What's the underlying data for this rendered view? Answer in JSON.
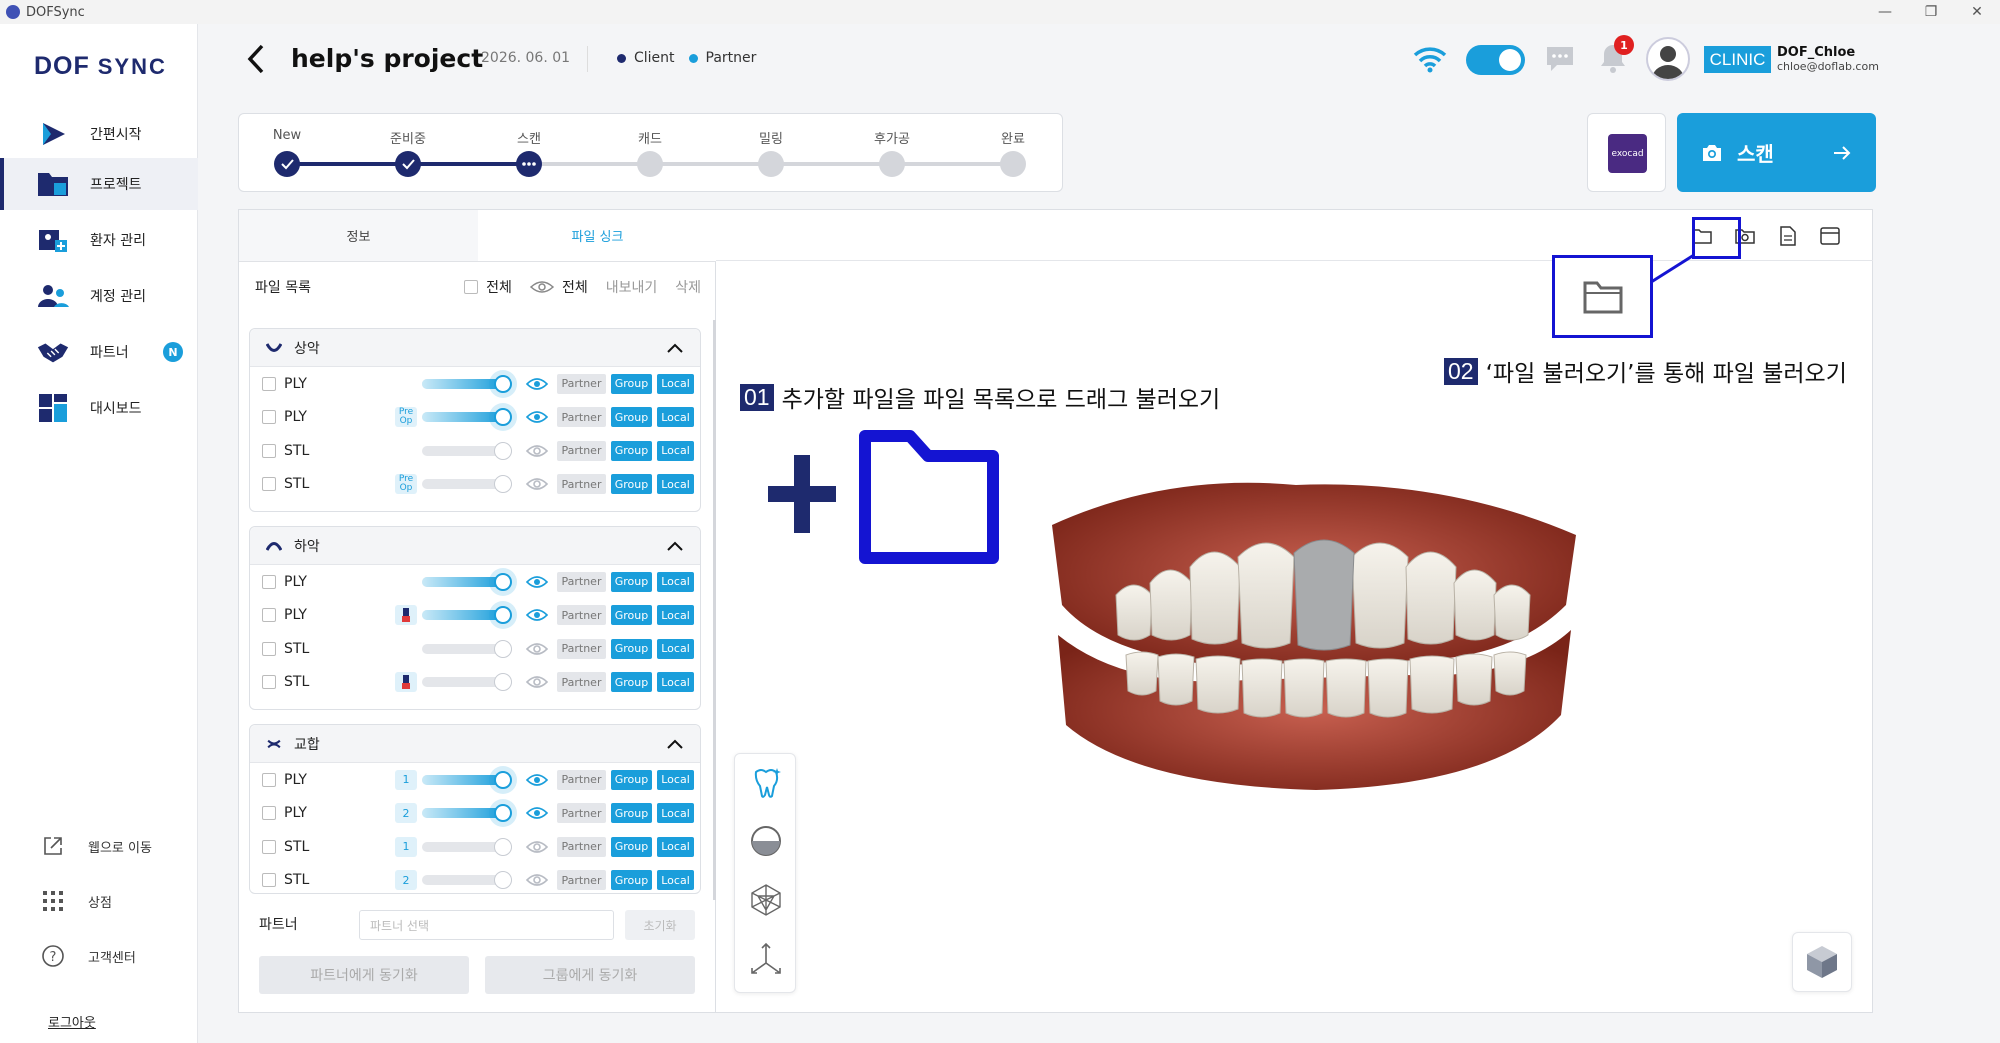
{
  "window": {
    "title": "DOFSync",
    "controls": [
      "—",
      "❐",
      "✕"
    ]
  },
  "sidebar": {
    "logo": {
      "main": "DOF",
      "sub": "SYNC"
    },
    "items": [
      {
        "label": "간편시작",
        "icon": "play-icon"
      },
      {
        "label": "프로젝트",
        "icon": "folder-icon",
        "active": true
      },
      {
        "label": "환자 관리",
        "icon": "patient-icon"
      },
      {
        "label": "계정 관리",
        "icon": "account-icon"
      },
      {
        "label": "파트너",
        "icon": "handshake-icon",
        "badge": "N"
      },
      {
        "label": "대시보드",
        "icon": "dashboard-icon"
      }
    ],
    "bottom": [
      {
        "label": "웹으로 이동",
        "icon": "external-link-icon"
      },
      {
        "label": "상점",
        "icon": "grid-icon"
      },
      {
        "label": "고객센터",
        "icon": "help-icon"
      }
    ],
    "logout": "로그아웃"
  },
  "header": {
    "title": "help's project",
    "date": "2026. 06. 01",
    "legend": [
      {
        "label": "Client",
        "color": "#1e2a6e"
      },
      {
        "label": "Partner",
        "color": "#1a9edb"
      }
    ],
    "notification_count": "1",
    "clinic_badge": "CLINIC",
    "user_name": "DOF_Chloe",
    "user_email": "chloe@doflab.com"
  },
  "progress": {
    "steps": [
      {
        "label": "New",
        "state": "done"
      },
      {
        "label": "준비중",
        "state": "done"
      },
      {
        "label": "스캔",
        "state": "current"
      },
      {
        "label": "캐드",
        "state": "pending"
      },
      {
        "label": "밀링",
        "state": "pending"
      },
      {
        "label": "후가공",
        "state": "pending"
      },
      {
        "label": "완료",
        "state": "pending"
      }
    ]
  },
  "exocad": {
    "label": "exocad"
  },
  "scan_button": {
    "label": "스캔"
  },
  "panel": {
    "tabs": [
      {
        "label": "정보"
      },
      {
        "label": "파일 싱크",
        "active": true
      }
    ],
    "filelist": {
      "title": "파일 목록",
      "select_all": "전체",
      "view_all": "전체",
      "export": "내보내기",
      "delete": "삭제"
    },
    "groups": [
      {
        "title": "상악",
        "rows": [
          {
            "type": "PLY",
            "extra": "",
            "on": true
          },
          {
            "type": "PLY",
            "extra": "Pre Op",
            "on": true
          },
          {
            "type": "STL",
            "extra": "",
            "on": false
          },
          {
            "type": "STL",
            "extra": "Pre Op",
            "on": false
          }
        ]
      },
      {
        "title": "하악",
        "rows": [
          {
            "type": "PLY",
            "extra": "",
            "on": true
          },
          {
            "type": "PLY",
            "extra": "tooth",
            "on": true
          },
          {
            "type": "STL",
            "extra": "",
            "on": false
          },
          {
            "type": "STL",
            "extra": "tooth",
            "on": false
          }
        ]
      },
      {
        "title": "교합",
        "rows": [
          {
            "type": "PLY",
            "extra": "1",
            "on": true
          },
          {
            "type": "PLY",
            "extra": "2",
            "on": true
          },
          {
            "type": "STL",
            "extra": "1",
            "on": false
          },
          {
            "type": "STL",
            "extra": "2",
            "on": false
          }
        ]
      }
    ],
    "pills": {
      "partner": "Partner",
      "group": "Group",
      "local": "Local"
    },
    "partner_label": "파트너",
    "partner_placeholder": "파트너 선택",
    "reset": "초기화",
    "sync_partner": "파트너에게 동기화",
    "sync_group": "그룹에게 동기화"
  },
  "viewer": {
    "annotation1": {
      "num": "01",
      "text": "추가할 파일을 파일 목록으로 드래그 불러오기"
    },
    "annotation2": {
      "num": "02",
      "text": "‘파일 불러오기’를 통해 파일 불러오기"
    },
    "highlight_color": "#1414d2"
  }
}
